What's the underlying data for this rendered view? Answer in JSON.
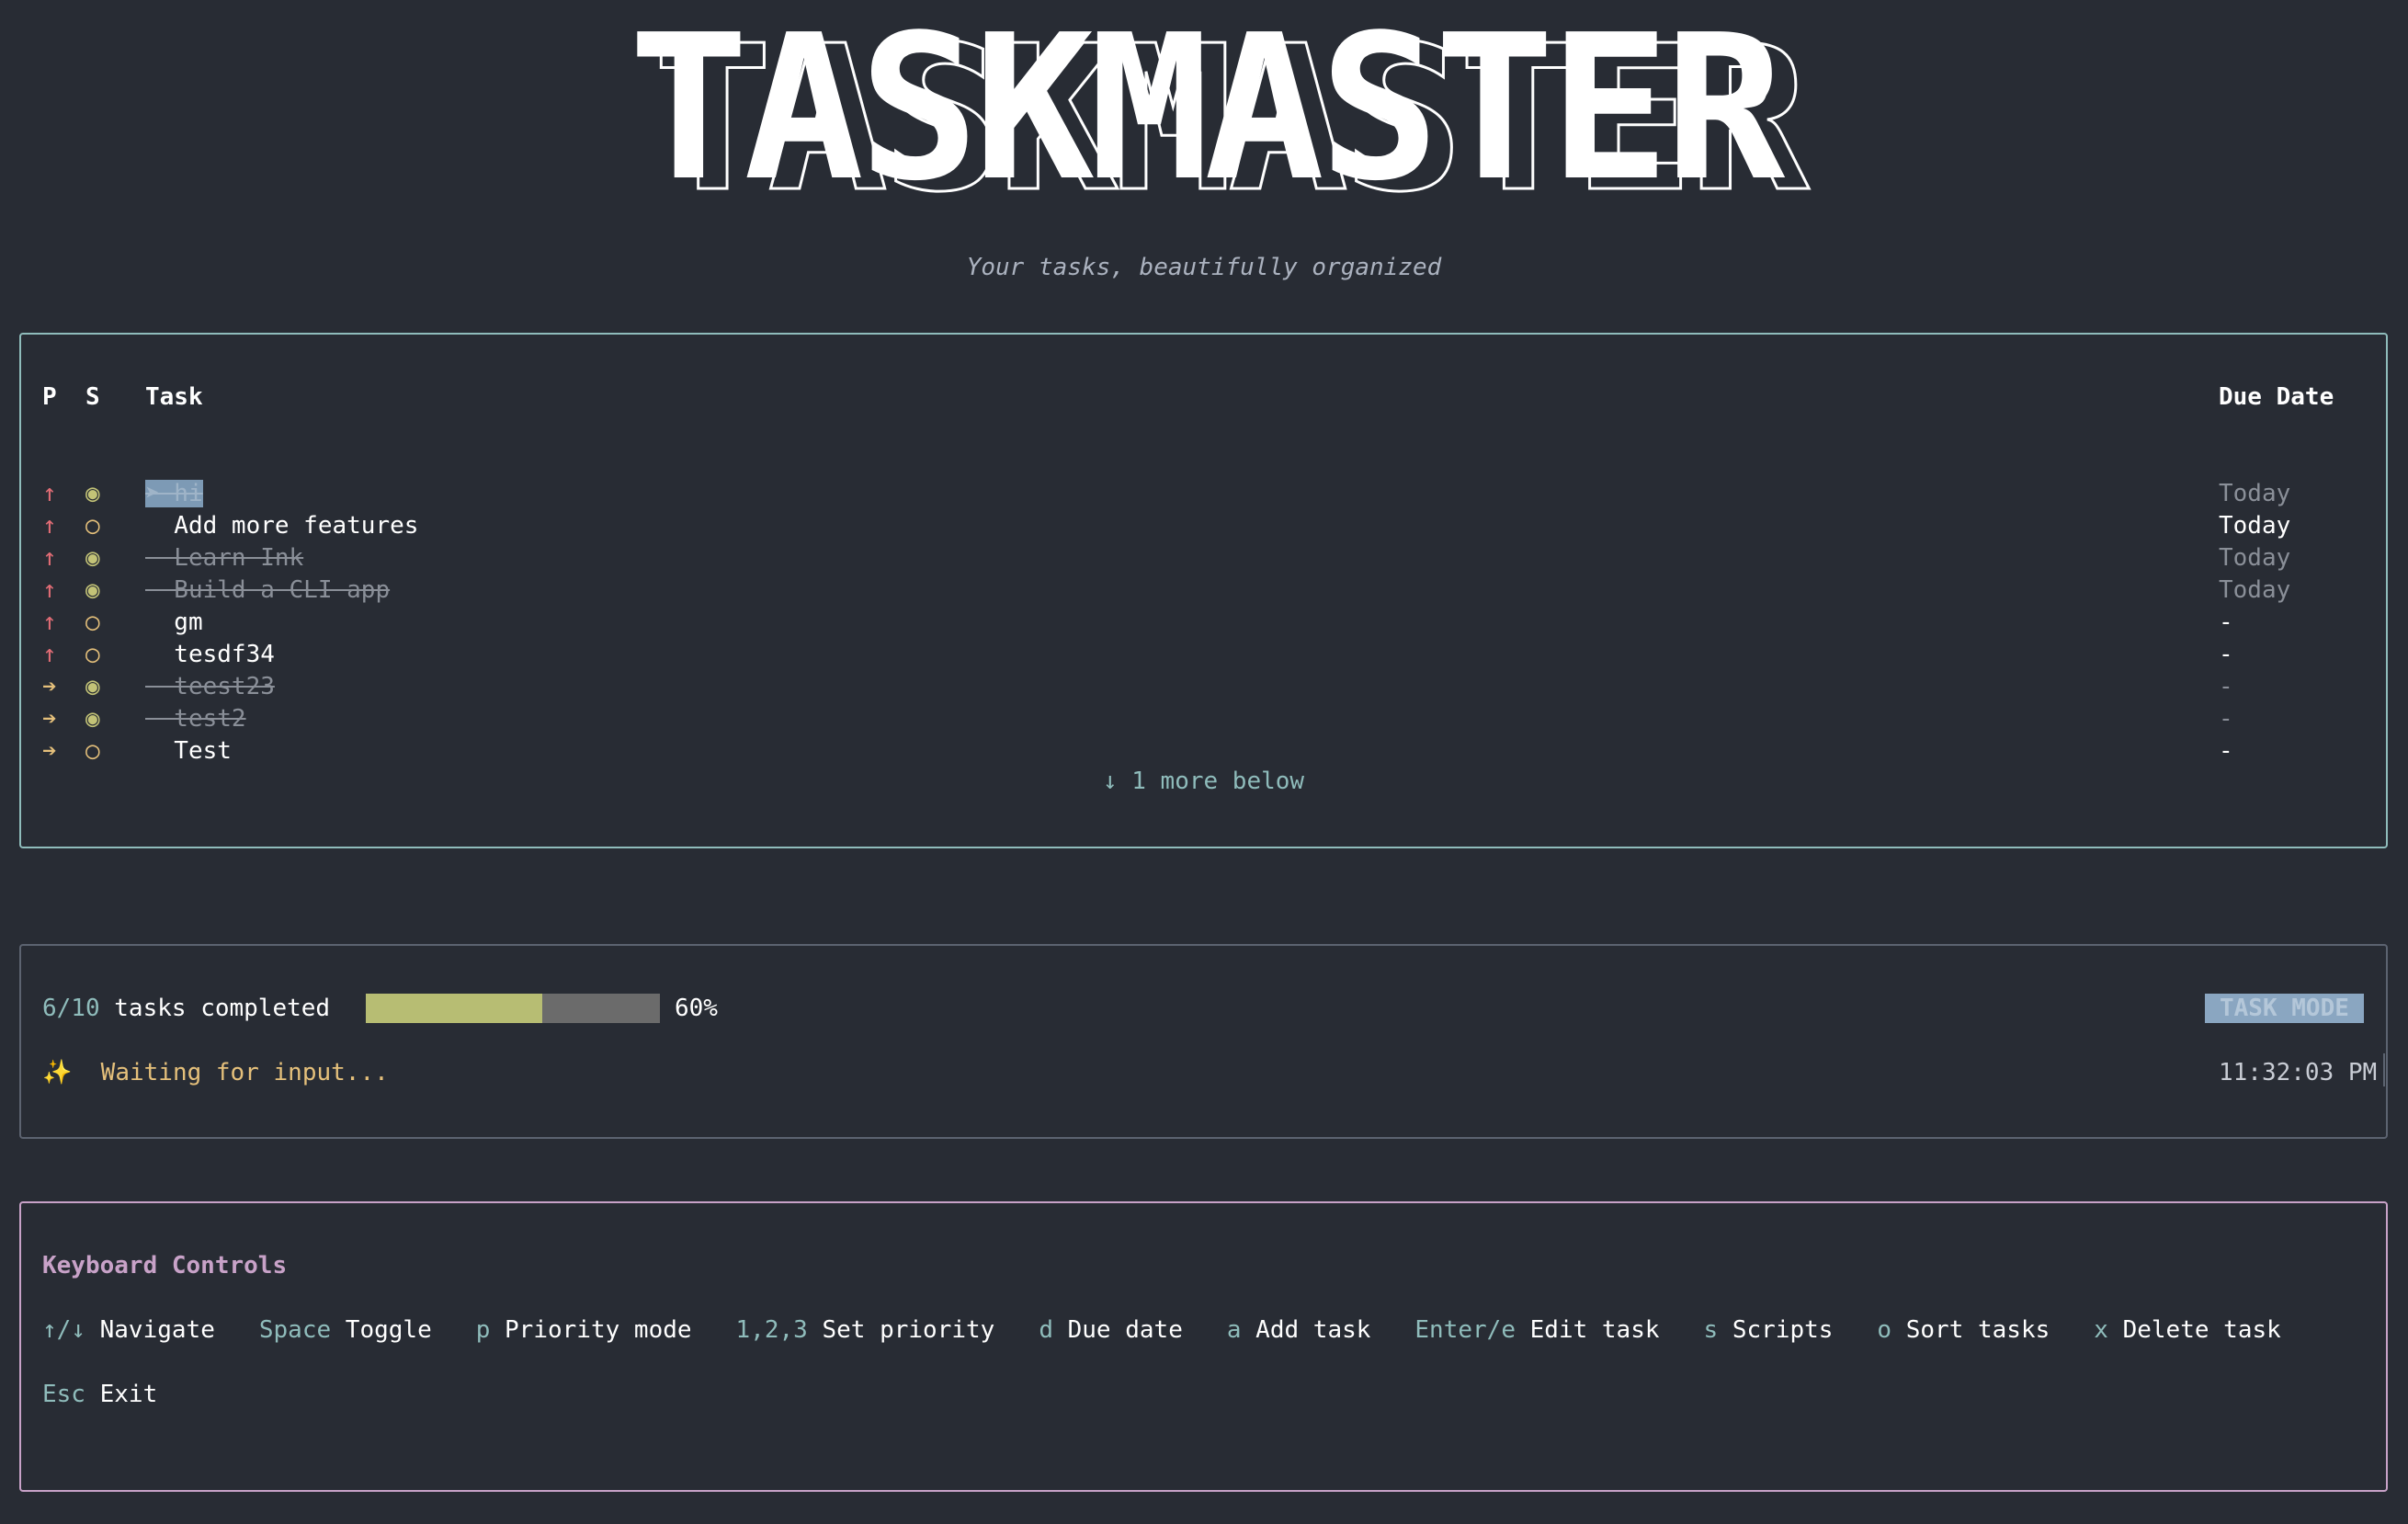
{
  "app": {
    "title": "TASKMASTER",
    "subtitle": "Your tasks, beautifully organized"
  },
  "colors": {
    "background": "#282c34",
    "priority_high": "#e06c75",
    "priority_medium": "#e5c07b",
    "done_status": "#c3c377",
    "accent_teal": "#8fbcbb",
    "controls_border": "#c8a2c8",
    "progress_fill": "#b7bd73",
    "mode_badge": "#8aa6c1"
  },
  "table": {
    "headers": {
      "priority": "P",
      "status": "S",
      "task": "Task",
      "due": "Due Date"
    },
    "rows": [
      {
        "priority": "↑",
        "priority_level": "high",
        "status": "◉",
        "done": true,
        "selected": true,
        "task": "➤ hi",
        "due": "Today"
      },
      {
        "priority": "↑",
        "priority_level": "high",
        "status": "○",
        "done": false,
        "selected": false,
        "task": "  Add more features",
        "due": "Today"
      },
      {
        "priority": "↑",
        "priority_level": "high",
        "status": "◉",
        "done": true,
        "selected": false,
        "task": "  Learn Ink",
        "due": "Today"
      },
      {
        "priority": "↑",
        "priority_level": "high",
        "status": "◉",
        "done": true,
        "selected": false,
        "task": "  Build a CLI app",
        "due": "Today"
      },
      {
        "priority": "↑",
        "priority_level": "high",
        "status": "○",
        "done": false,
        "selected": false,
        "task": "  gm",
        "due": "-"
      },
      {
        "priority": "↑",
        "priority_level": "high",
        "status": "○",
        "done": false,
        "selected": false,
        "task": "  tesdf34",
        "due": "-"
      },
      {
        "priority": "➔",
        "priority_level": "medium",
        "status": "◉",
        "done": true,
        "selected": false,
        "task": "  teest23",
        "due": "-"
      },
      {
        "priority": "➔",
        "priority_level": "medium",
        "status": "◉",
        "done": true,
        "selected": false,
        "task": "  test2",
        "due": "-"
      },
      {
        "priority": "➔",
        "priority_level": "medium",
        "status": "○",
        "done": false,
        "selected": false,
        "task": "  Test",
        "due": "-"
      }
    ],
    "more_below": "↓ 1 more below"
  },
  "status": {
    "completed_count": "6/10",
    "completed_label": " tasks completed",
    "progress_fraction": 0.6,
    "progress_percent": "60%",
    "mode": "TASK MODE",
    "waiting_icon": "✨",
    "waiting_text": "  Waiting for input...",
    "clock": "11:32:03 PM"
  },
  "controls": {
    "title": "Keyboard Controls",
    "items": [
      {
        "key": "↑/↓",
        "desc": "Navigate"
      },
      {
        "key": "Space",
        "desc": "Toggle"
      },
      {
        "key": "p",
        "desc": "Priority mode"
      },
      {
        "key": "1,2,3",
        "desc": "Set priority"
      },
      {
        "key": "d",
        "desc": "Due date"
      },
      {
        "key": "a",
        "desc": "Add task"
      },
      {
        "key": "Enter/e",
        "desc": "Edit task"
      },
      {
        "key": "s",
        "desc": "Scripts"
      },
      {
        "key": "o",
        "desc": "Sort tasks"
      },
      {
        "key": "x",
        "desc": "Delete task"
      },
      {
        "key": "Esc",
        "desc": "Exit"
      }
    ]
  }
}
